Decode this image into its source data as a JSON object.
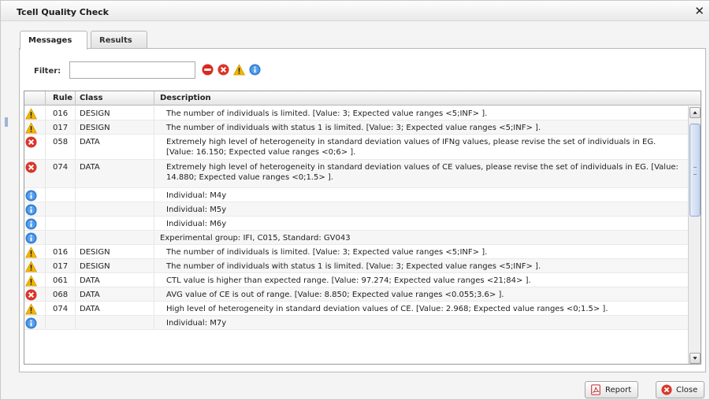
{
  "window": {
    "title": "Tcell Quality Check",
    "close_glyph": "✕"
  },
  "tabs": [
    {
      "label": "Messages",
      "active": true
    },
    {
      "label": "Results",
      "active": false
    }
  ],
  "filter": {
    "label": "Filter:",
    "value": "",
    "placeholder": ""
  },
  "filter_icons": [
    "stop-icon",
    "error-icon",
    "warning-icon",
    "info-icon"
  ],
  "grid": {
    "columns": [
      "Rule",
      "Class",
      "Description"
    ],
    "rows": [
      {
        "icon": "warning",
        "rule": "016",
        "class": "DESIGN",
        "description": "The number of individuals is limited.   [Value: 3; Expected value ranges <5;INF> ]."
      },
      {
        "icon": "warning",
        "rule": "017",
        "class": "DESIGN",
        "description": "The number of individuals with status 1 is limited.   [Value: 3; Expected value ranges <5;INF> ]."
      },
      {
        "icon": "error",
        "rule": "058",
        "class": "DATA",
        "description": "Extremely high level of heterogeneity in standard deviation values of IFNg values, please revise the set of individuals in EG.   [Value: 16.150; Expected value ranges <0;6> ]."
      },
      {
        "icon": "error",
        "rule": "074",
        "class": "DATA",
        "description": "Extremely high level of heterogeneity in standard deviation values of CE values, please revise the set of individuals in EG.   [Value: 14.880; Expected value ranges <0;1.5> ]."
      },
      {
        "icon": "info",
        "rule": "",
        "class": "",
        "description": "Individual: M4y"
      },
      {
        "icon": "info",
        "rule": "",
        "class": "",
        "description": "Individual: M5y"
      },
      {
        "icon": "info",
        "rule": "",
        "class": "",
        "description": "Individual: M6y"
      },
      {
        "icon": "info",
        "rule": "",
        "class": "",
        "description": "Experimental group: IFI, C015, Standard: GV043"
      },
      {
        "icon": "warning",
        "rule": "016",
        "class": "DESIGN",
        "description": "The number of individuals is limited.   [Value: 3; Expected value ranges <5;INF> ]."
      },
      {
        "icon": "warning",
        "rule": "017",
        "class": "DESIGN",
        "description": "The number of individuals with status 1 is limited.   [Value: 3; Expected value ranges <5;INF> ]."
      },
      {
        "icon": "warning",
        "rule": "061",
        "class": "DATA",
        "description": "CTL value is higher than expected range.   [Value: 97.274; Expected value ranges <21;84> ]."
      },
      {
        "icon": "error",
        "rule": "068",
        "class": "DATA",
        "description": "AVG value of CE is out of range.   [Value: 8.850; Expected value ranges <0.055;3.6> ]."
      },
      {
        "icon": "warning",
        "rule": "074",
        "class": "DATA",
        "description": "High level of heterogeneity in standard deviation values of CE.   [Value: 2.968; Expected value ranges <0;1.5> ]."
      },
      {
        "icon": "info",
        "rule": "",
        "class": "",
        "description": "Individual: M7y"
      }
    ]
  },
  "buttons": {
    "report": "Report",
    "close": "Close"
  },
  "colors": {
    "warning": "#f2b400",
    "error": "#d9362b",
    "info": "#2f7fd6",
    "stop": "#d82a20"
  }
}
